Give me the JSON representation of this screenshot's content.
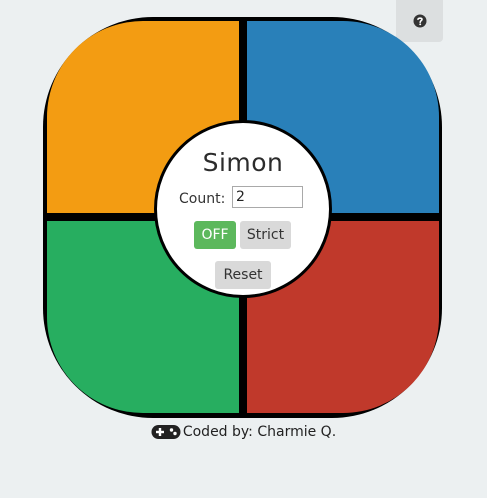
{
  "help": {
    "icon": "question-circle-icon"
  },
  "board": {
    "pads": [
      {
        "id": "yellow",
        "color": "#f39c12"
      },
      {
        "id": "blue",
        "color": "#2980b9"
      },
      {
        "id": "green",
        "color": "#27ae60"
      },
      {
        "id": "red",
        "color": "#c0392b"
      }
    ]
  },
  "center": {
    "title": "Simon",
    "count_label": "Count:",
    "count_value": "2",
    "power_label": "OFF",
    "strict_label": "Strict",
    "reset_label": "Reset"
  },
  "footer": {
    "icon": "gamepad-icon",
    "text": "Coded by: Charmie Q."
  }
}
